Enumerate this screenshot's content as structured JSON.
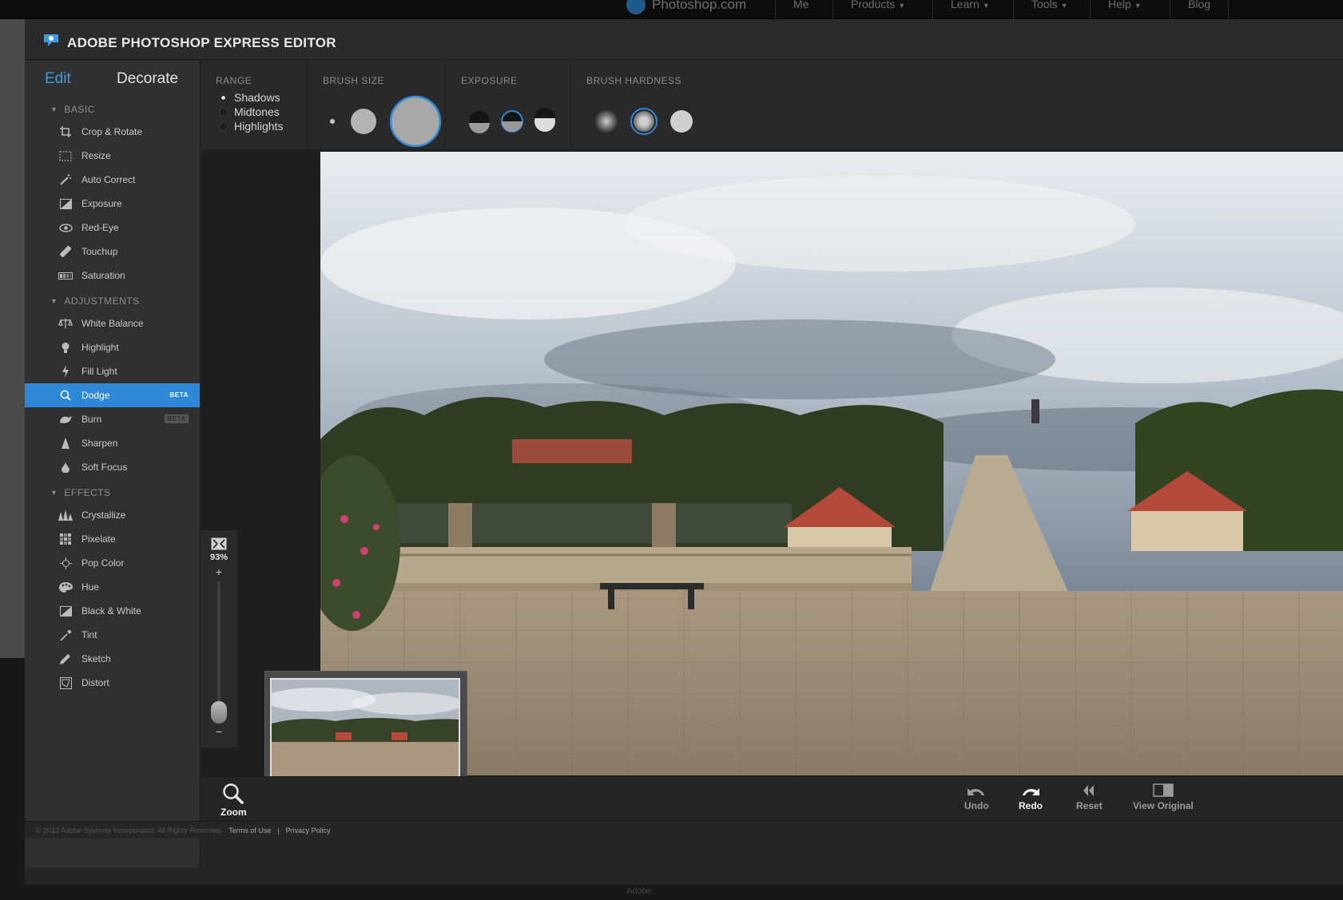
{
  "site_nav": {
    "logo": "Photoshop.com",
    "items": [
      {
        "label": "Me",
        "dropdown": false
      },
      {
        "label": "Products",
        "dropdown": true
      },
      {
        "label": "Learn",
        "dropdown": true
      },
      {
        "label": "Tools",
        "dropdown": true
      },
      {
        "label": "Help",
        "dropdown": true
      },
      {
        "label": "Blog",
        "dropdown": false
      }
    ]
  },
  "app": {
    "title": "ADOBE PHOTOSHOP EXPRESS EDITOR"
  },
  "sidebar": {
    "tabs": {
      "edit": "Edit",
      "decorate": "Decorate"
    },
    "sections": {
      "basic": {
        "label": "BASIC",
        "items": [
          "Crop & Rotate",
          "Resize",
          "Auto Correct",
          "Exposure",
          "Red-Eye",
          "Touchup",
          "Saturation"
        ]
      },
      "adjustments": {
        "label": "ADJUSTMENTS",
        "items": [
          "White Balance",
          "Highlight",
          "Fill Light",
          "Dodge",
          "Burn",
          "Sharpen",
          "Soft Focus"
        ]
      },
      "effects": {
        "label": "EFFECTS",
        "items": [
          "Crystallize",
          "Pixelate",
          "Pop Color",
          "Hue",
          "Black & White",
          "Tint",
          "Sketch",
          "Distort"
        ]
      }
    },
    "badges": {
      "dodge": "BETA",
      "burn": "BETA"
    },
    "active_item": "Dodge"
  },
  "options": {
    "range": {
      "label": "RANGE",
      "options": [
        "Shadows",
        "Midtones",
        "Highlights"
      ],
      "selected": "Shadows"
    },
    "brush_size": {
      "label": "BRUSH SIZE",
      "selected_index": 2
    },
    "exposure": {
      "label": "EXPOSURE",
      "selected_index": 1
    },
    "brush_hardness": {
      "label": "BRUSH HARDNESS",
      "selected_index": 1
    }
  },
  "zoom": {
    "level": "93%",
    "plus": "+",
    "minus": "−",
    "slider_fraction": 0.12
  },
  "toolbar": {
    "zoom": "Zoom",
    "undo": "Undo",
    "redo": "Redo",
    "reset": "Reset",
    "view_original": "View Original"
  },
  "footer": {
    "copyright": "© 2013 Adobe Systems Incorporated. All Rights Reserved.",
    "terms": "Terms of Use",
    "separator": "|",
    "privacy": "Privacy Policy"
  },
  "outer_footer": "Adobe",
  "colors": {
    "accent": "#2f87d8",
    "edit_tab": "#3d9be0",
    "background": "#262626"
  }
}
